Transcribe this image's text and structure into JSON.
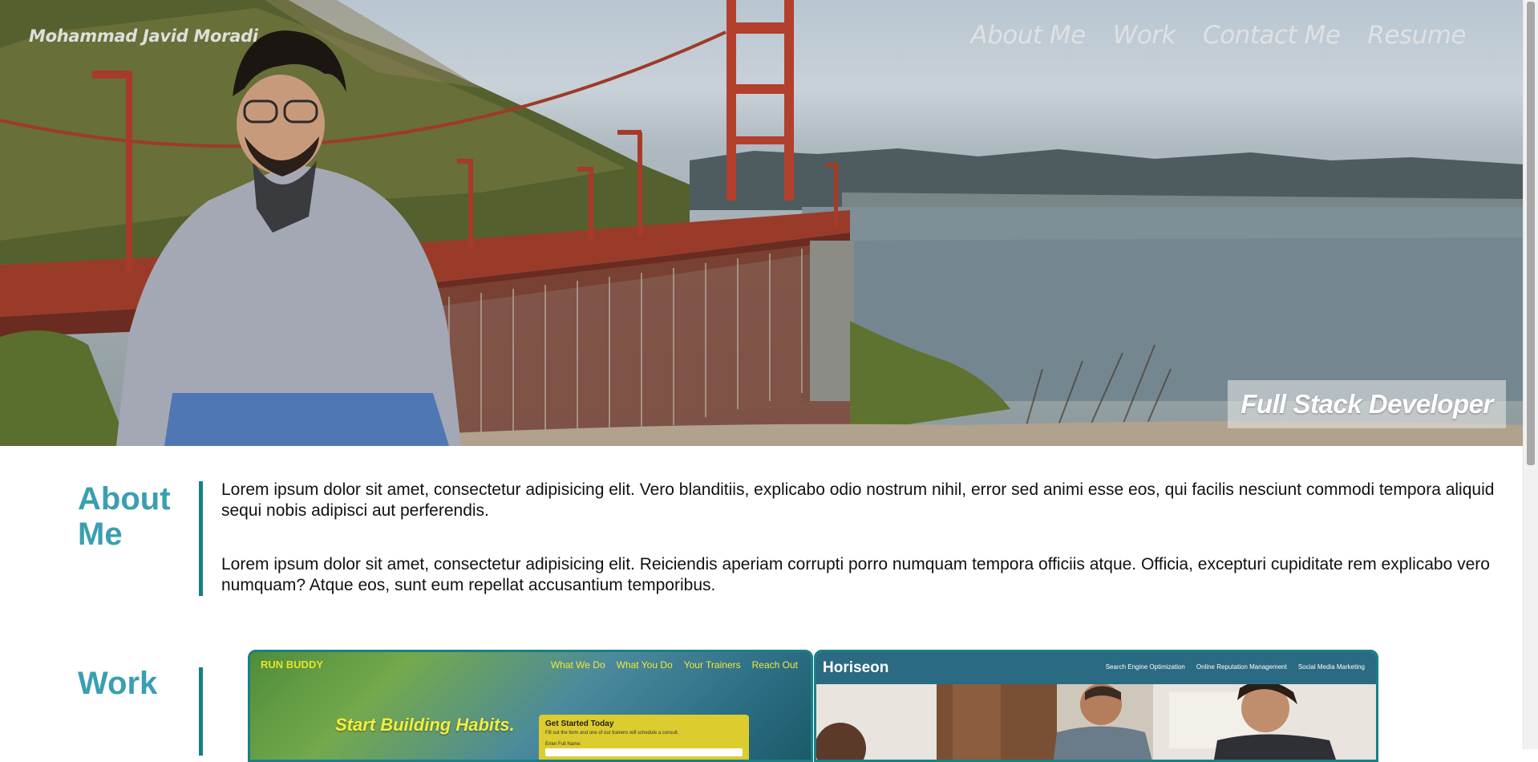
{
  "header": {
    "brand": "Mohammad Javid Moradi",
    "nav": [
      "About Me",
      "Work",
      "Contact Me",
      "Resume"
    ],
    "tagline": "Full Stack Developer"
  },
  "about": {
    "title": "About Me",
    "paragraphs": [
      "Lorem ipsum dolor sit amet, consectetur adipisicing elit. Vero blanditiis, explicabo odio nostrum nihil, error sed animi esse eos, qui facilis nesciunt commodi tempora aliquid sequi nobis adipisci aut perferendis.",
      "Lorem ipsum dolor sit amet, consectetur adipisicing elit. Reiciendis aperiam corrupti porro numquam tempora officiis atque. Officia, excepturi cupiditate rem explicabo vero numquam? Atque eos, sunt eum repellat accusantium temporibus."
    ]
  },
  "work": {
    "title": "Work",
    "projects": [
      {
        "name": "RUN BUDDY",
        "nav": [
          "What We Do",
          "What You Do",
          "Your Trainers",
          "Reach Out"
        ],
        "headline": "Start Building Habits.",
        "form_title": "Get Started Today",
        "form_text": "Fill out the form and one of our trainers will schedule a consult.",
        "form_label": "Enter Full Name:"
      },
      {
        "name": "Horiseon",
        "nav": [
          "Search Engine Optimization",
          "Online Reputation Management",
          "Social Media Marketing"
        ]
      }
    ]
  },
  "colors": {
    "accent": "#3a9fb0",
    "rule": "#167f85",
    "horiseon_bar": "#2a6a82",
    "runbuddy_yellow": "#f4ee3c"
  }
}
